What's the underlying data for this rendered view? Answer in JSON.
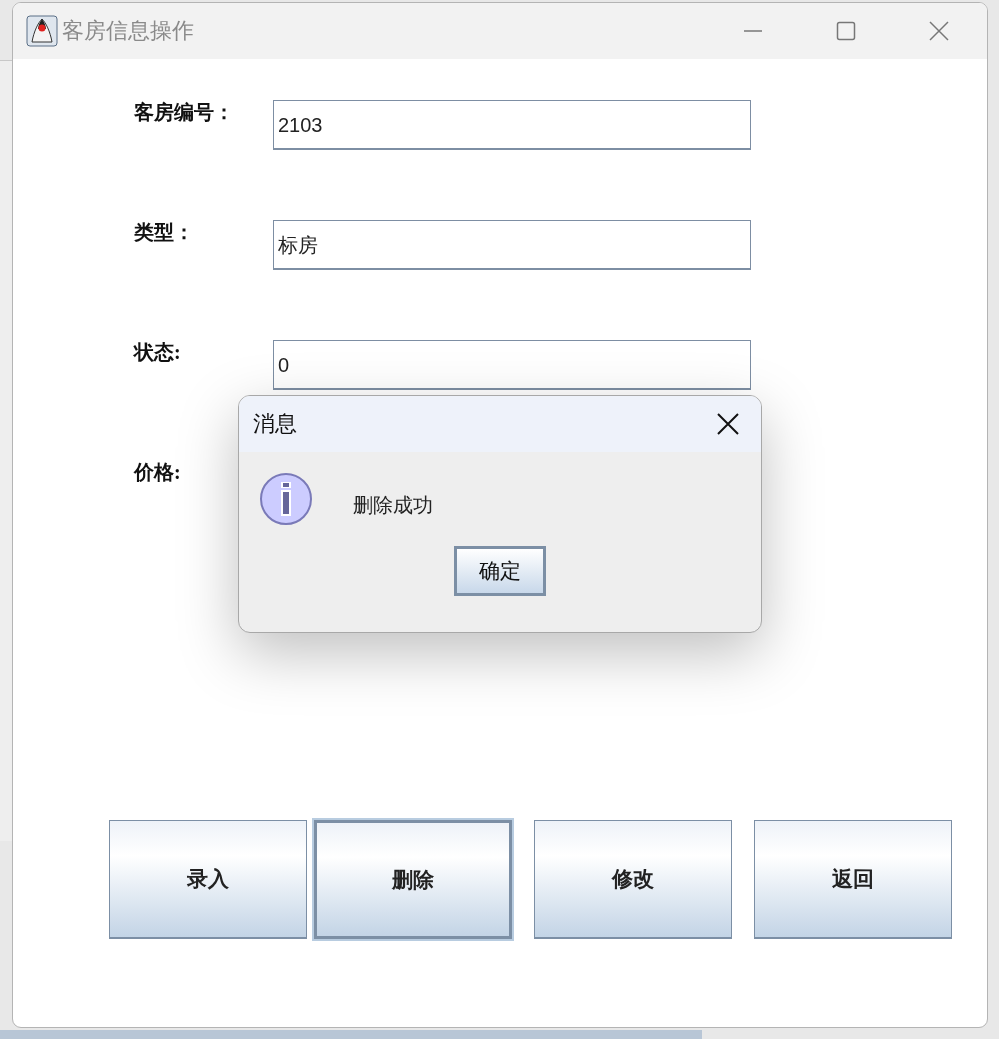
{
  "window": {
    "title": "客房信息操作"
  },
  "form": {
    "fields": [
      {
        "label": "客房编号：",
        "value": "2103"
      },
      {
        "label": "类型：",
        "value": "标房"
      },
      {
        "label": "状态:",
        "value": "0"
      },
      {
        "label": "价格:"
      }
    ]
  },
  "buttons": [
    {
      "label": "录入",
      "focused": false
    },
    {
      "label": "删除",
      "focused": true
    },
    {
      "label": "修改",
      "focused": false
    },
    {
      "label": "返回",
      "focused": false
    }
  ],
  "dialog": {
    "title": "消息",
    "message": "删除成功",
    "button": "确定"
  }
}
